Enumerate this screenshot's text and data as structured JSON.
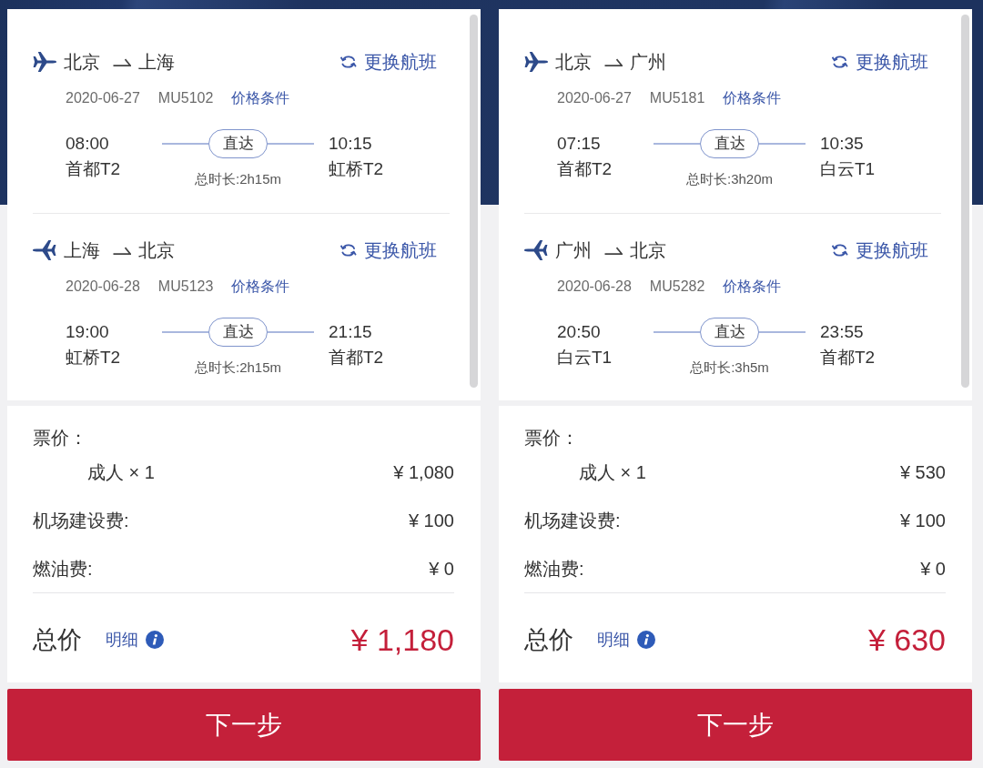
{
  "panels": [
    {
      "flights": [
        {
          "kind": "outbound",
          "from": "北京",
          "to": "上海",
          "change_link": "更换航班",
          "date": "2020-06-27",
          "flight_no": "MU5102",
          "conditions_link": "价格条件",
          "depart_time": "08:00",
          "depart_airport": "首都T2",
          "stop_badge": "直达",
          "duration": "总时长:2h15m",
          "arrive_time": "10:15",
          "arrive_airport": "虹桥T2"
        },
        {
          "kind": "return",
          "from": "上海",
          "to": "北京",
          "change_link": "更换航班",
          "date": "2020-06-28",
          "flight_no": "MU5123",
          "conditions_link": "价格条件",
          "depart_time": "19:00",
          "depart_airport": "虹桥T2",
          "stop_badge": "直达",
          "duration": "总时长:2h15m",
          "arrive_time": "21:15",
          "arrive_airport": "首都T2"
        }
      ],
      "fare": {
        "heading": "票价：",
        "items": [
          {
            "kind": "passenger",
            "label": "成人 × 1",
            "amount": "¥ 1,080"
          },
          {
            "kind": "fee",
            "label": "机场建设费:",
            "amount": "¥ 100"
          },
          {
            "kind": "fee",
            "label": "燃油费:",
            "amount": "¥ 0"
          }
        ]
      },
      "total": {
        "label": "总价",
        "details_link": "明细",
        "amount": "¥ 1,180"
      },
      "next_button": "下一步"
    },
    {
      "flights": [
        {
          "kind": "outbound",
          "from": "北京",
          "to": "广州",
          "change_link": "更换航班",
          "date": "2020-06-27",
          "flight_no": "MU5181",
          "conditions_link": "价格条件",
          "depart_time": "07:15",
          "depart_airport": "首都T2",
          "stop_badge": "直达",
          "duration": "总时长:3h20m",
          "arrive_time": "10:35",
          "arrive_airport": "白云T1"
        },
        {
          "kind": "return",
          "from": "广州",
          "to": "北京",
          "change_link": "更换航班",
          "date": "2020-06-28",
          "flight_no": "MU5282",
          "conditions_link": "价格条件",
          "depart_time": "20:50",
          "depart_airport": "白云T1",
          "stop_badge": "直达",
          "duration": "总时长:3h5m",
          "arrive_time": "23:55",
          "arrive_airport": "首都T2"
        }
      ],
      "fare": {
        "heading": "票价：",
        "items": [
          {
            "kind": "passenger",
            "label": "成人 × 1",
            "amount": "¥ 530"
          },
          {
            "kind": "fee",
            "label": "机场建设费:",
            "amount": "¥ 100"
          },
          {
            "kind": "fee",
            "label": "燃油费:",
            "amount": "¥ 0"
          }
        ]
      },
      "total": {
        "label": "总价",
        "details_link": "明细",
        "amount": "¥ 630"
      },
      "next_button": "下一步"
    }
  ]
}
